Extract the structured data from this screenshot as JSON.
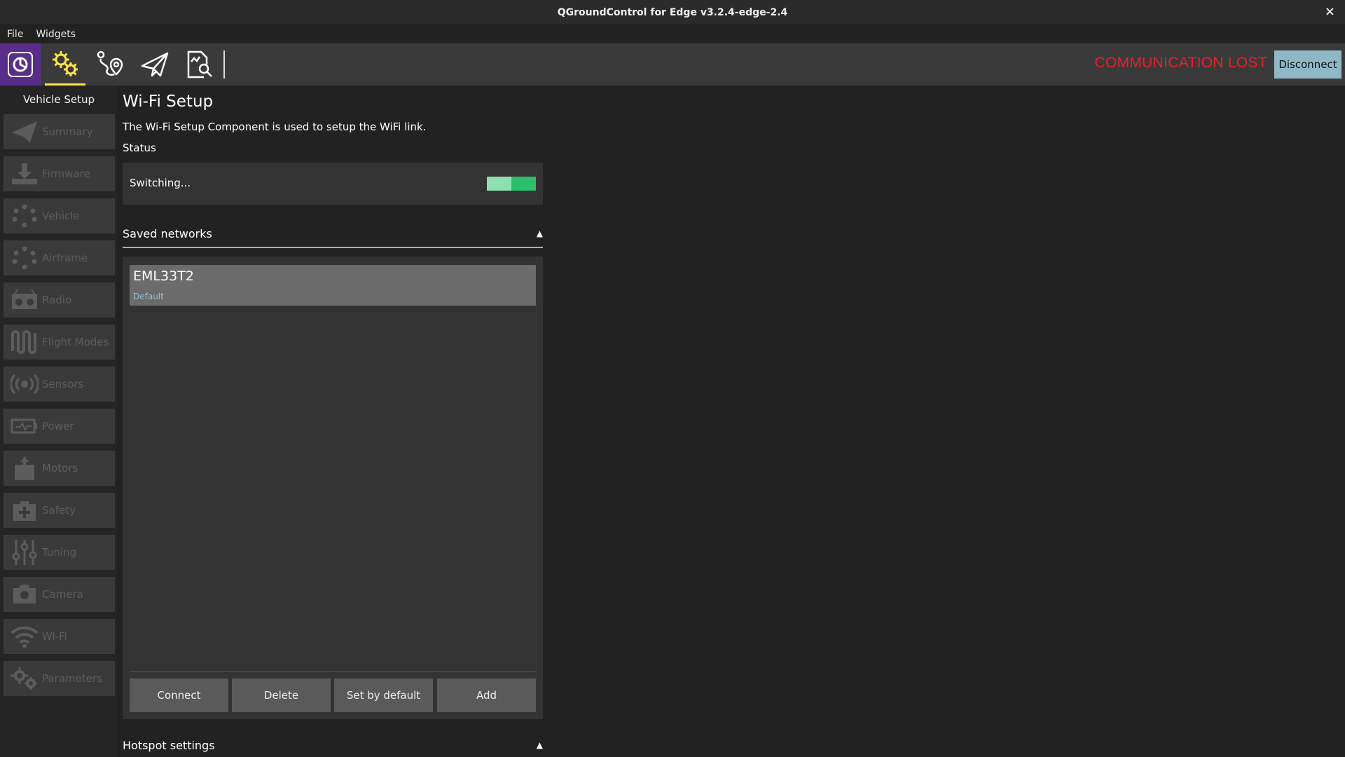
{
  "window": {
    "title": "QGroundControl for Edge v3.2.4-edge-2.4",
    "close": "×"
  },
  "menu": {
    "items": [
      "File",
      "Widgets"
    ]
  },
  "toolbar": {
    "status": "COMMUNICATION LOST",
    "disconnect_label": "Disconnect",
    "status_color": "#e8202a",
    "accent": "#ffe44d",
    "icons": [
      "qgc-logo-icon",
      "vehicle-setup-gear-icon",
      "plan-view-icon",
      "fly-view-icon",
      "analyze-view-icon"
    ]
  },
  "sidebar": {
    "title": "Vehicle Setup",
    "items": [
      {
        "label": "Summary",
        "icon": "paper-plane-icon"
      },
      {
        "label": "Firmware",
        "icon": "download-icon"
      },
      {
        "label": "Vehicle",
        "icon": "vehicle-dots-icon"
      },
      {
        "label": "Airframe",
        "icon": "airframe-icon"
      },
      {
        "label": "Radio",
        "icon": "radio-icon"
      },
      {
        "label": "Flight Modes",
        "icon": "flight-modes-icon"
      },
      {
        "label": "Sensors",
        "icon": "sensors-icon"
      },
      {
        "label": "Power",
        "icon": "power-icon"
      },
      {
        "label": "Motors",
        "icon": "motors-icon"
      },
      {
        "label": "Safety",
        "icon": "safety-icon"
      },
      {
        "label": "Tuning",
        "icon": "tuning-icon"
      },
      {
        "label": "Camera",
        "icon": "camera-icon"
      },
      {
        "label": "Wi-Fi",
        "icon": "wifi-icon"
      },
      {
        "label": "Parameters",
        "icon": "parameters-icon"
      }
    ]
  },
  "main": {
    "title": "Wi-Fi Setup",
    "description": "The Wi-Fi Setup Component is used to setup the WiFi link.",
    "status_label": "Status",
    "status_text": "Switching...",
    "saved_networks": {
      "header": "Saved networks",
      "networks": [
        {
          "name": "EML33T2",
          "sub": "Default"
        }
      ],
      "buttons": [
        "Connect",
        "Delete",
        "Set by default",
        "Add"
      ]
    },
    "hotspot_header": "Hotspot settings"
  }
}
